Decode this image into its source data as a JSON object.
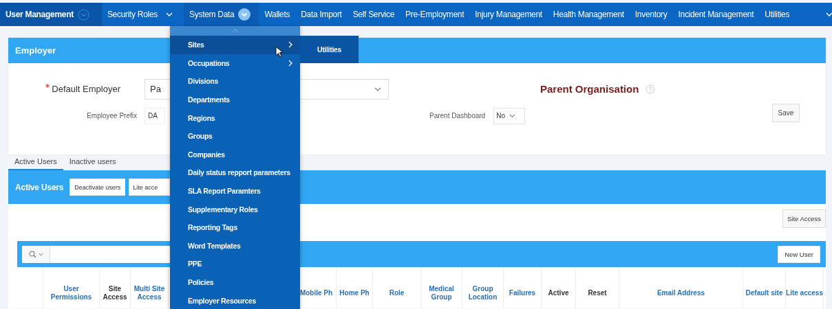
{
  "nav": {
    "items": [
      {
        "label": "User Management",
        "selected": true,
        "kind": "outline"
      },
      {
        "label": "Security Roles",
        "selected": false,
        "kind": "chevron"
      },
      {
        "label": "System Data",
        "selected": false,
        "kind": "filled"
      },
      {
        "label": "Wallets",
        "selected": false
      },
      {
        "label": "Data Import",
        "selected": false
      },
      {
        "label": "Self Service",
        "selected": false
      },
      {
        "label": "Pre-Employment",
        "selected": false
      },
      {
        "label": "Injury Management",
        "selected": false
      },
      {
        "label": "Health Management",
        "selected": false
      },
      {
        "label": "Inventory",
        "selected": false
      },
      {
        "label": "Incident Management",
        "selected": false
      },
      {
        "label": "Utilities",
        "selected": false
      }
    ]
  },
  "menu": {
    "items": [
      {
        "label": "Sites",
        "hovered": true,
        "has_submenu": true
      },
      {
        "label": "Occupations",
        "hovered": false,
        "has_submenu": true
      },
      {
        "label": "Divisions",
        "hovered": false,
        "has_submenu": false
      },
      {
        "label": "Departments",
        "hovered": false,
        "has_submenu": false
      },
      {
        "label": "Regions",
        "hovered": false,
        "has_submenu": false
      },
      {
        "label": "Groups",
        "hovered": false,
        "has_submenu": false
      },
      {
        "label": "Companies",
        "hovered": false,
        "has_submenu": false
      },
      {
        "label": "Daily status repport parameters",
        "hovered": false,
        "has_submenu": false
      },
      {
        "label": "SLA Report Paramters",
        "hovered": false,
        "has_submenu": false
      },
      {
        "label": "Supplementary Roles",
        "hovered": false,
        "has_submenu": false
      },
      {
        "label": "Reporting Tags",
        "hovered": false,
        "has_submenu": false
      },
      {
        "label": "Word Templates",
        "hovered": false,
        "has_submenu": false
      },
      {
        "label": "PPE",
        "hovered": false,
        "has_submenu": false
      },
      {
        "label": "Policies",
        "hovered": false,
        "has_submenu": false
      },
      {
        "label": "Employer Resources",
        "hovered": false,
        "has_submenu": false
      }
    ],
    "submenu": {
      "items": [
        "Utilities"
      ]
    }
  },
  "employer": {
    "title": "Employer",
    "default_employer": {
      "label": "Default Employer",
      "required": true,
      "value": "Pa"
    },
    "employee_prefix": {
      "label": "Employee Prefix",
      "value": "DA"
    },
    "parent_organisation": {
      "title": "Parent Organisation"
    },
    "parent_dashboard": {
      "label": "Parent Dashboard",
      "value": "No"
    },
    "save_button": "Save"
  },
  "tabs": [
    {
      "label": "Active Users",
      "selected": true
    },
    {
      "label": "Inactive users",
      "selected": false
    }
  ],
  "users_panel": {
    "title": "Active Users",
    "buttons": [
      "Deactivate users",
      "Lite acce"
    ],
    "site_access_button": "Site Access",
    "new_user_button": "New User",
    "columns": [
      {
        "label": "User Permissions",
        "link": true
      },
      {
        "label": "Site Access",
        "link": false
      },
      {
        "label": "Multi Site Access",
        "link": true
      },
      {
        "label": "Mobile Ph",
        "link": true
      },
      {
        "label": "Home Ph",
        "link": true
      },
      {
        "label": "Role",
        "link": true
      },
      {
        "label": "Medical Group",
        "link": true
      },
      {
        "label": "Group Location",
        "link": true
      },
      {
        "label": "Failures",
        "link": true
      },
      {
        "label": "Active",
        "link": false
      },
      {
        "label": "Reset",
        "link": false
      },
      {
        "label": "Email Address",
        "link": true
      },
      {
        "label": "Default site",
        "link": true
      },
      {
        "label": "Lite access",
        "link": true
      }
    ]
  }
}
